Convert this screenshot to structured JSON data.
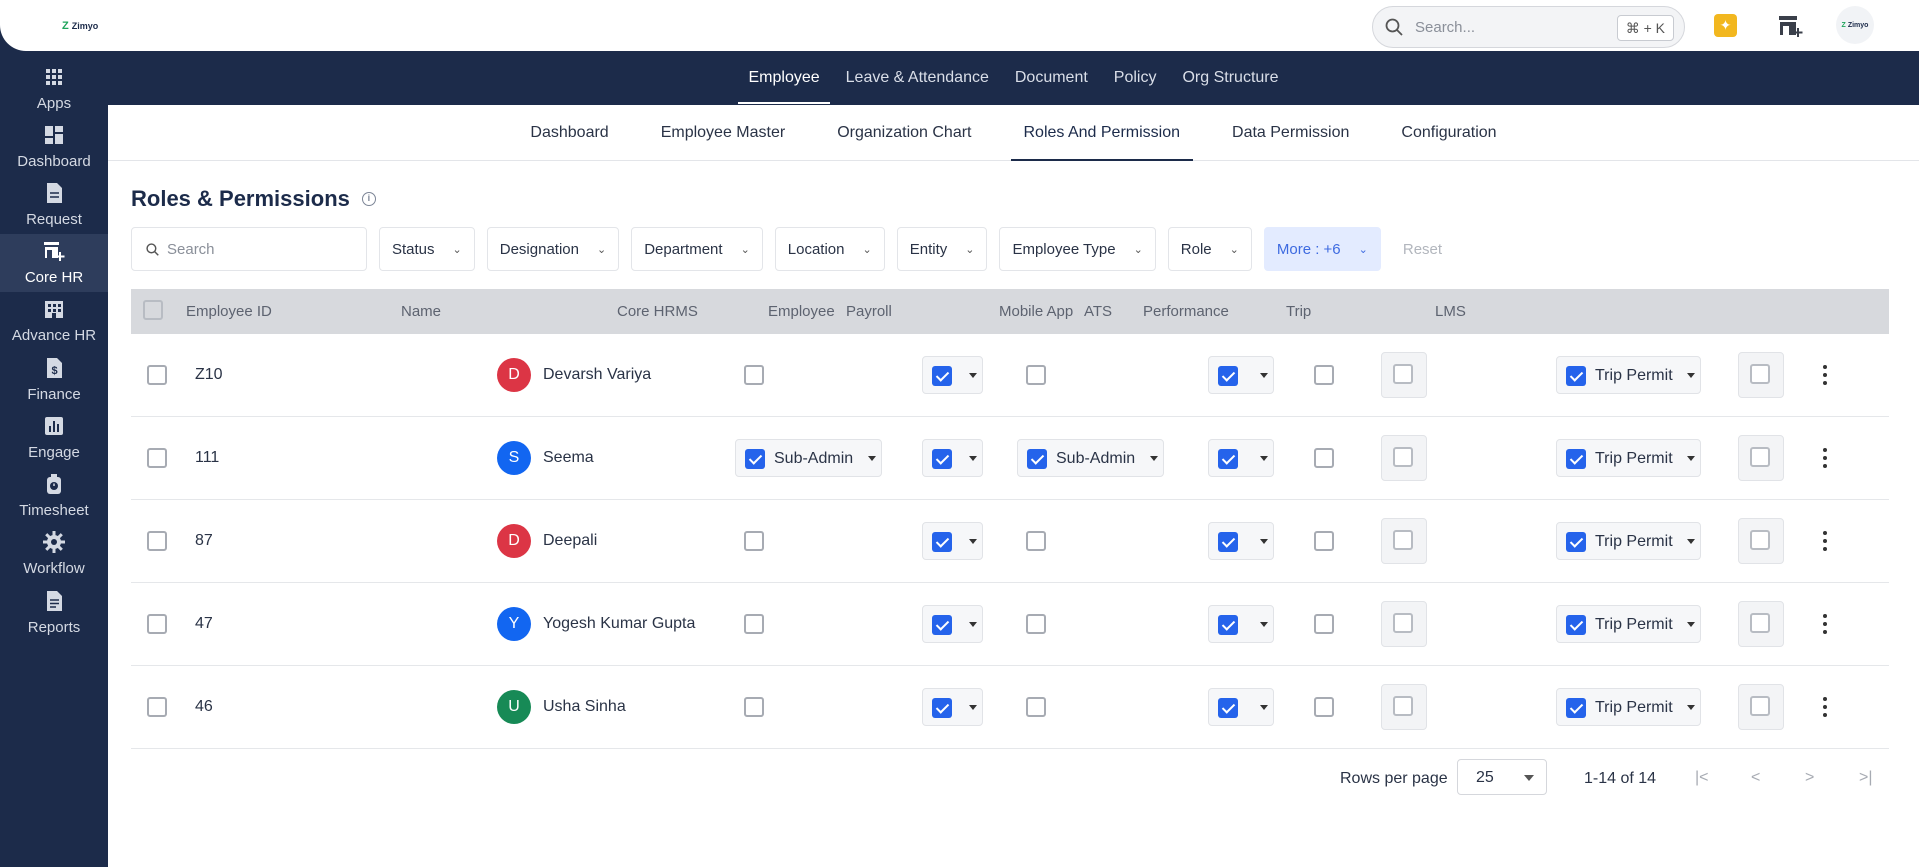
{
  "brand": {
    "logo_text": "Zimyo"
  },
  "global_search": {
    "placeholder": "Search...",
    "shortcut": "⌘ + K"
  },
  "main_nav": [
    "Employee",
    "Leave & Attendance",
    "Document",
    "Policy",
    "Org Structure"
  ],
  "main_nav_active": "Employee",
  "sidebar": [
    {
      "label": "Apps",
      "icon": "grid-icon"
    },
    {
      "label": "Dashboard",
      "icon": "dashboard-icon"
    },
    {
      "label": "Request",
      "icon": "document-icon"
    },
    {
      "label": "Core HR",
      "icon": "store-plus-icon",
      "active": true
    },
    {
      "label": "Advance HR",
      "icon": "building-icon"
    },
    {
      "label": "Finance",
      "icon": "dollar-doc-icon"
    },
    {
      "label": "Engage",
      "icon": "bar-chart-icon"
    },
    {
      "label": "Timesheet",
      "icon": "stopwatch-icon"
    },
    {
      "label": "Workflow",
      "icon": "gear-icon"
    },
    {
      "label": "Reports",
      "icon": "report-icon"
    }
  ],
  "sub_nav": [
    "Dashboard",
    "Employee Master",
    "Organization Chart",
    "Roles And Permission",
    "Data Permission",
    "Configuration"
  ],
  "sub_nav_active": "Roles And Permission",
  "page": {
    "title": "Roles & Permissions"
  },
  "filters": {
    "search_placeholder": "Search",
    "buttons": [
      "Status",
      "Designation",
      "Department",
      "Location",
      "Entity",
      "Employee Type",
      "Role"
    ],
    "more_label": "More : +6",
    "reset_label": "Reset"
  },
  "table": {
    "columns": [
      "Employee ID",
      "Name",
      "Core HRMS",
      "Employee",
      "Payroll",
      "Mobile App",
      "ATS",
      "Performance",
      "Trip",
      "LMS"
    ],
    "rows": [
      {
        "id": "Z10",
        "initial": "D",
        "name": "Devarsh Variya",
        "avatar_color": "#dc3545",
        "core_hrms": "",
        "employee": true,
        "payroll": "",
        "mobile_app": true,
        "ats": false,
        "performance": false,
        "trip": "Trip Permit",
        "lms": false
      },
      {
        "id": "111",
        "initial": "S",
        "name": "Seema",
        "avatar_color": "#1266f1",
        "core_hrms": "Sub-Admin",
        "employee": true,
        "payroll": "Sub-Admin",
        "mobile_app": true,
        "ats": false,
        "performance": false,
        "trip": "Trip Permit",
        "lms": false
      },
      {
        "id": "87",
        "initial": "D",
        "name": "Deepali",
        "avatar_color": "#dc3545",
        "core_hrms": "",
        "employee": true,
        "payroll": "",
        "mobile_app": true,
        "ats": false,
        "performance": false,
        "trip": "Trip Permit",
        "lms": false
      },
      {
        "id": "47",
        "initial": "Y",
        "name": "Yogesh Kumar Gupta",
        "avatar_color": "#1266f1",
        "core_hrms": "",
        "employee": true,
        "payroll": "",
        "mobile_app": true,
        "ats": false,
        "performance": false,
        "trip": "Trip Permit",
        "lms": false
      },
      {
        "id": "46",
        "initial": "U",
        "name": "Usha Sinha",
        "avatar_color": "#178a56",
        "core_hrms": "",
        "employee": true,
        "payroll": "",
        "mobile_app": true,
        "ats": false,
        "performance": false,
        "trip": "Trip Permit",
        "lms": false
      }
    ]
  },
  "pagination": {
    "rows_per_page_label": "Rows per page",
    "rows_per_page": "25",
    "range": "1-14 of 14"
  }
}
